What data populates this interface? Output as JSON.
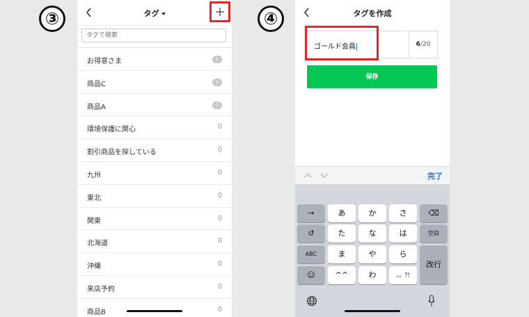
{
  "step_markers": {
    "left": "③",
    "right": "④"
  },
  "tag_list_screen": {
    "title": "タグ",
    "search_placeholder": "タグで検索",
    "tags": [
      {
        "label": "お得意さま",
        "count": "1",
        "badge": true
      },
      {
        "label": "商品C",
        "count": "1",
        "badge": true
      },
      {
        "label": "商品A",
        "count": "1",
        "badge": true
      },
      {
        "label": "環境保護に関心",
        "count": "0",
        "badge": false
      },
      {
        "label": "割引商品を探している",
        "count": "0",
        "badge": false
      },
      {
        "label": "九州",
        "count": "0",
        "badge": false
      },
      {
        "label": "東北",
        "count": "0",
        "badge": false
      },
      {
        "label": "関東",
        "count": "0",
        "badge": false
      },
      {
        "label": "北海道",
        "count": "0",
        "badge": false
      },
      {
        "label": "沖縄",
        "count": "0",
        "badge": false
      },
      {
        "label": "来店予約",
        "count": "0",
        "badge": false
      },
      {
        "label": "商品B",
        "count": "0",
        "badge": false
      }
    ],
    "icons": {
      "back": "chevron-left-icon",
      "add": "plus-icon",
      "title_caret": "caret-down-icon"
    }
  },
  "create_tag_screen": {
    "title": "タグを作成",
    "input_value": "ゴールド会員",
    "counter_current": "6",
    "counter_max": "/20",
    "save_label": "保存",
    "done_label": "完了",
    "keyboard": {
      "row1": [
        "→",
        "あ",
        "か",
        "さ",
        "⌫"
      ],
      "row2": [
        "↺",
        "た",
        "な",
        "は",
        "空白"
      ],
      "row3": [
        "ABC",
        "ま",
        "や",
        "ら",
        "改行"
      ],
      "row4": [
        "☺",
        "^^",
        "わ",
        "、。?!"
      ]
    },
    "icons": {
      "back": "chevron-left-icon",
      "prev": "chevron-up-icon",
      "next": "chevron-down-icon",
      "globe": "globe-icon",
      "mic": "microphone-icon"
    }
  },
  "colors": {
    "highlight": "#e3262a",
    "save_button": "#06c755",
    "link": "#1a73e8"
  }
}
